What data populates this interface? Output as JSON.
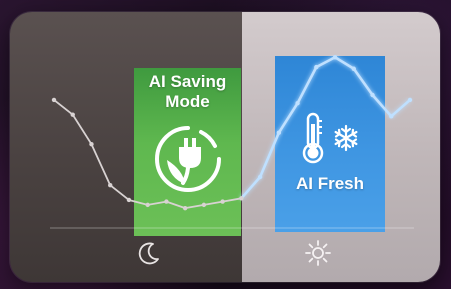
{
  "modes": {
    "saving": {
      "title_line1": "AI Saving",
      "title_line2": "Mode",
      "icon": "plug-leaf-icon"
    },
    "fresh": {
      "title": "AI Fresh",
      "icons": [
        "thermometer-icon",
        "snowflake-icon"
      ]
    }
  },
  "bottom_icons": {
    "left": "moon-icon",
    "right": "sun-icon"
  },
  "colors": {
    "saving_green": "#5fb84f",
    "fresh_blue": "#3f96e2",
    "line_dim": "#d8d2d2",
    "line_glow": "#bfe0ff"
  },
  "chart_data": {
    "type": "line",
    "title": "",
    "xlabel": "",
    "ylabel": "",
    "grid": false,
    "series": [
      {
        "values": [
          0.72,
          0.63,
          0.45,
          0.2,
          0.11,
          0.08,
          0.1,
          0.06,
          0.08,
          0.1,
          0.12,
          0.25,
          0.52,
          0.7,
          0.92,
          0.98,
          0.91,
          0.75,
          0.62,
          0.72
        ]
      }
    ],
    "ylim": [
      0,
      1
    ]
  }
}
